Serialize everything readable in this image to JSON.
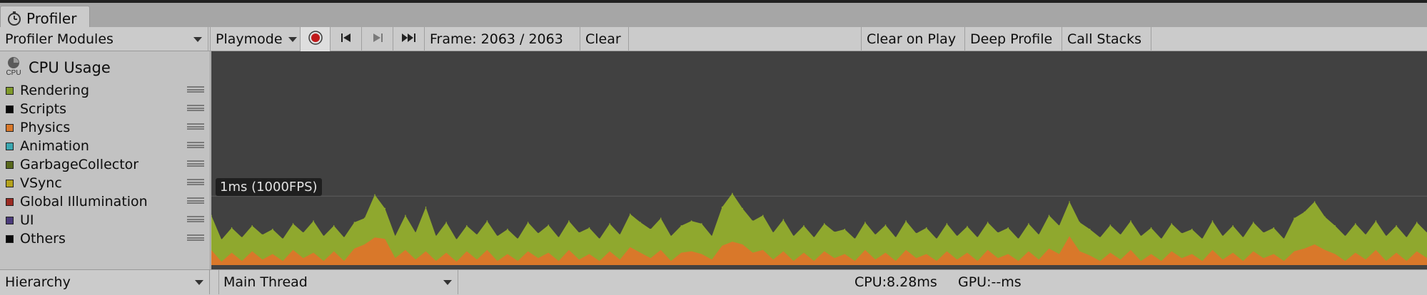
{
  "window": {
    "tab_title": "Profiler"
  },
  "toolbar": {
    "modules_dropdown": "Profiler Modules",
    "mode_dropdown": "Playmode",
    "frame_label": "Frame: 2063 / 2063",
    "clear": "Clear",
    "clear_on_play": "Clear on Play",
    "deep_profile": "Deep Profile",
    "call_stacks": "Call Stacks"
  },
  "cpu_module": {
    "icon_text": "CPU",
    "title": "CPU Usage",
    "legend": [
      {
        "name": "Rendering",
        "color": "#7f9a2a"
      },
      {
        "name": "Scripts",
        "color": "#0a0a0a"
      },
      {
        "name": "Physics",
        "color": "#d9782a"
      },
      {
        "name": "Animation",
        "color": "#3aa7b0"
      },
      {
        "name": "GarbageCollector",
        "color": "#58681c"
      },
      {
        "name": "VSync",
        "color": "#b4a21b"
      },
      {
        "name": "Global Illumination",
        "color": "#9b2a22"
      },
      {
        "name": "UI",
        "color": "#4a3a7a"
      },
      {
        "name": "Others",
        "color": "#0a0a0a"
      }
    ],
    "fps_marker": "1ms (1000FPS)"
  },
  "chart_data": {
    "type": "area",
    "title": "CPU Usage",
    "ylabel": "",
    "reference_line": "1ms (1000FPS)",
    "ylim": [
      0,
      3.1
    ],
    "x": [
      1,
      2,
      3,
      4,
      5,
      6,
      7,
      8,
      9,
      10,
      11,
      12,
      13,
      14,
      15,
      16,
      17,
      18,
      19,
      20,
      21,
      22,
      23,
      24,
      25,
      26,
      27,
      28,
      29,
      30,
      31,
      32,
      33,
      34,
      35,
      36,
      37,
      38,
      39,
      40,
      41,
      42,
      43,
      44,
      45,
      46,
      47,
      48,
      49,
      50,
      51,
      52,
      53,
      54,
      55,
      56,
      57,
      58,
      59,
      60,
      61,
      62,
      63,
      64,
      65,
      66,
      67,
      68,
      69,
      70,
      71,
      72,
      73,
      74,
      75,
      76,
      77,
      78,
      79,
      80,
      81,
      82,
      83,
      84,
      85,
      86,
      87,
      88,
      89,
      90,
      91,
      92,
      93,
      94,
      95,
      96,
      97,
      98,
      99,
      100,
      101,
      102,
      103,
      104,
      105,
      106,
      107,
      108,
      109,
      110,
      111,
      112,
      113,
      114,
      115,
      116,
      117,
      118,
      119,
      120
    ],
    "series": [
      {
        "name": "Rendering",
        "color": "#8fa82e",
        "values": [
          0.7,
          0.35,
          0.52,
          0.38,
          0.55,
          0.42,
          0.5,
          0.36,
          0.58,
          0.45,
          0.62,
          0.4,
          0.55,
          0.38,
          0.6,
          0.66,
          1.0,
          0.8,
          0.4,
          0.7,
          0.45,
          0.82,
          0.4,
          0.6,
          0.35,
          0.55,
          0.42,
          0.62,
          0.4,
          0.5,
          0.36,
          0.6,
          0.44,
          0.56,
          0.38,
          0.62,
          0.45,
          0.52,
          0.36,
          0.58,
          0.42,
          0.72,
          0.6,
          0.5,
          0.66,
          0.4,
          0.55,
          0.62,
          0.58,
          0.4,
          0.82,
          1.02,
          0.8,
          0.62,
          0.7,
          0.45,
          0.64,
          0.4,
          0.55,
          0.38,
          0.58,
          0.46,
          0.5,
          0.36,
          0.6,
          0.42,
          0.56,
          0.38,
          0.62,
          0.44,
          0.52,
          0.36,
          0.58,
          0.4,
          0.54,
          0.38,
          0.6,
          0.45,
          0.52,
          0.36,
          0.58,
          0.42,
          0.7,
          0.55,
          0.9,
          0.6,
          0.5,
          0.38,
          0.56,
          0.42,
          0.62,
          0.4,
          0.52,
          0.36,
          0.58,
          0.44,
          0.5,
          0.36,
          0.62,
          0.4,
          0.55,
          0.38,
          0.6,
          0.45,
          0.52,
          0.36,
          0.66,
          0.75,
          0.9,
          0.68,
          0.55,
          0.4,
          0.58,
          0.42,
          0.62,
          0.4,
          0.55,
          0.38,
          0.6,
          0.45
        ]
      },
      {
        "name": "Physics",
        "color": "#d9782a",
        "values": [
          0.22,
          0.05,
          0.18,
          0.06,
          0.2,
          0.08,
          0.16,
          0.06,
          0.22,
          0.1,
          0.18,
          0.06,
          0.2,
          0.06,
          0.24,
          0.3,
          0.4,
          0.38,
          0.1,
          0.22,
          0.08,
          0.2,
          0.06,
          0.18,
          0.05,
          0.2,
          0.08,
          0.22,
          0.06,
          0.16,
          0.06,
          0.2,
          0.1,
          0.18,
          0.06,
          0.22,
          0.08,
          0.16,
          0.06,
          0.2,
          0.08,
          0.26,
          0.18,
          0.1,
          0.22,
          0.06,
          0.18,
          0.2,
          0.16,
          0.08,
          0.28,
          0.34,
          0.3,
          0.18,
          0.22,
          0.08,
          0.2,
          0.06,
          0.18,
          0.06,
          0.2,
          0.1,
          0.16,
          0.06,
          0.22,
          0.08,
          0.18,
          0.06,
          0.22,
          0.1,
          0.16,
          0.06,
          0.2,
          0.08,
          0.18,
          0.06,
          0.22,
          0.1,
          0.16,
          0.06,
          0.2,
          0.08,
          0.24,
          0.16,
          0.42,
          0.2,
          0.14,
          0.06,
          0.18,
          0.08,
          0.22,
          0.06,
          0.16,
          0.06,
          0.2,
          0.1,
          0.16,
          0.06,
          0.22,
          0.08,
          0.18,
          0.06,
          0.2,
          0.1,
          0.16,
          0.06,
          0.2,
          0.24,
          0.3,
          0.22,
          0.16,
          0.06,
          0.18,
          0.08,
          0.22,
          0.06,
          0.18,
          0.06,
          0.2,
          0.1
        ]
      }
    ]
  },
  "bottom": {
    "view_dropdown": "Hierarchy",
    "thread_dropdown": "Main Thread",
    "cpu_time": "CPU:8.28ms",
    "gpu_time": "GPU:--ms"
  },
  "icons": {
    "profiler_tab": "stopwatch-icon",
    "record": "record-icon",
    "first_frame": "first-frame-icon",
    "next_frame": "next-frame-icon",
    "last_frame": "last-frame-icon",
    "cpu": "cpu-icon"
  }
}
